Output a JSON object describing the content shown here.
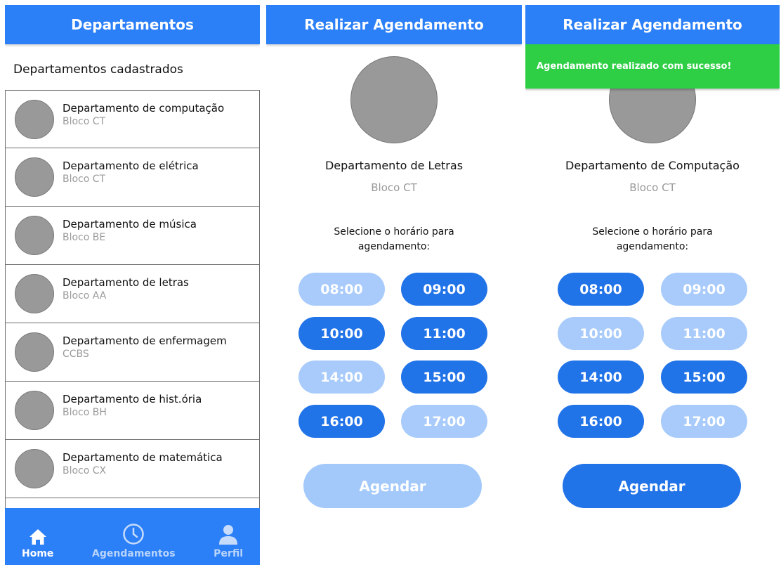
{
  "screen_list": {
    "title": "Departamentos",
    "section_title": "Departamentos cadastrados",
    "departments": [
      {
        "name": "Departamento de computação",
        "block": "Bloco CT"
      },
      {
        "name": "Departamento de elétrica",
        "block": "Bloco CT"
      },
      {
        "name": "Departamento de música",
        "block": "Bloco BE"
      },
      {
        "name": "Departamento de letras",
        "block": "Bloco AA"
      },
      {
        "name": "Departamento de enfermagem",
        "block": "CCBS"
      },
      {
        "name": "Departamento de hist.ória",
        "block": "Bloco BH"
      },
      {
        "name": "Departamento de matemática",
        "block": "Bloco CX"
      }
    ],
    "nav": {
      "home": {
        "label": "Home",
        "icon": "home-icon"
      },
      "appointments": {
        "label": "Agendamentos",
        "icon": "clock-icon"
      },
      "profile": {
        "label": "Perfil",
        "icon": "person-icon"
      }
    }
  },
  "screen_schedule_1": {
    "title": "Realizar Agendamento",
    "department": "Departamento de Letras",
    "block": "Bloco CT",
    "prompt_line1": "Selecione o horário para",
    "prompt_line2": "agendamento:",
    "slots": [
      {
        "time": "08:00",
        "available": false
      },
      {
        "time": "09:00",
        "available": true
      },
      {
        "time": "10:00",
        "available": true
      },
      {
        "time": "11:00",
        "available": true
      },
      {
        "time": "14:00",
        "available": false
      },
      {
        "time": "15:00",
        "available": true
      },
      {
        "time": "16:00",
        "available": true
      },
      {
        "time": "17:00",
        "available": false
      }
    ],
    "button_label": "Agendar",
    "button_enabled": false
  },
  "screen_schedule_2": {
    "title": "Realizar Agendamento",
    "toast": "Agendamento realizado com sucesso!",
    "department": "Departamento de Computação",
    "block": "Bloco CT",
    "prompt_line1": "Selecione o horário para",
    "prompt_line2": "agendamento:",
    "slots": [
      {
        "time": "08:00",
        "available": true
      },
      {
        "time": "09:00",
        "available": false
      },
      {
        "time": "10:00",
        "available": false
      },
      {
        "time": "11:00",
        "available": false
      },
      {
        "time": "14:00",
        "available": true
      },
      {
        "time": "15:00",
        "available": true
      },
      {
        "time": "16:00",
        "available": true
      },
      {
        "time": "17:00",
        "available": false
      }
    ],
    "button_label": "Agendar",
    "button_enabled": true
  },
  "colors": {
    "primary": "#2b7ff7",
    "slot_available": "#2173e8",
    "slot_unavailable": "#a8cbfb",
    "success": "#2ecf45",
    "avatar_gray": "#999999"
  }
}
